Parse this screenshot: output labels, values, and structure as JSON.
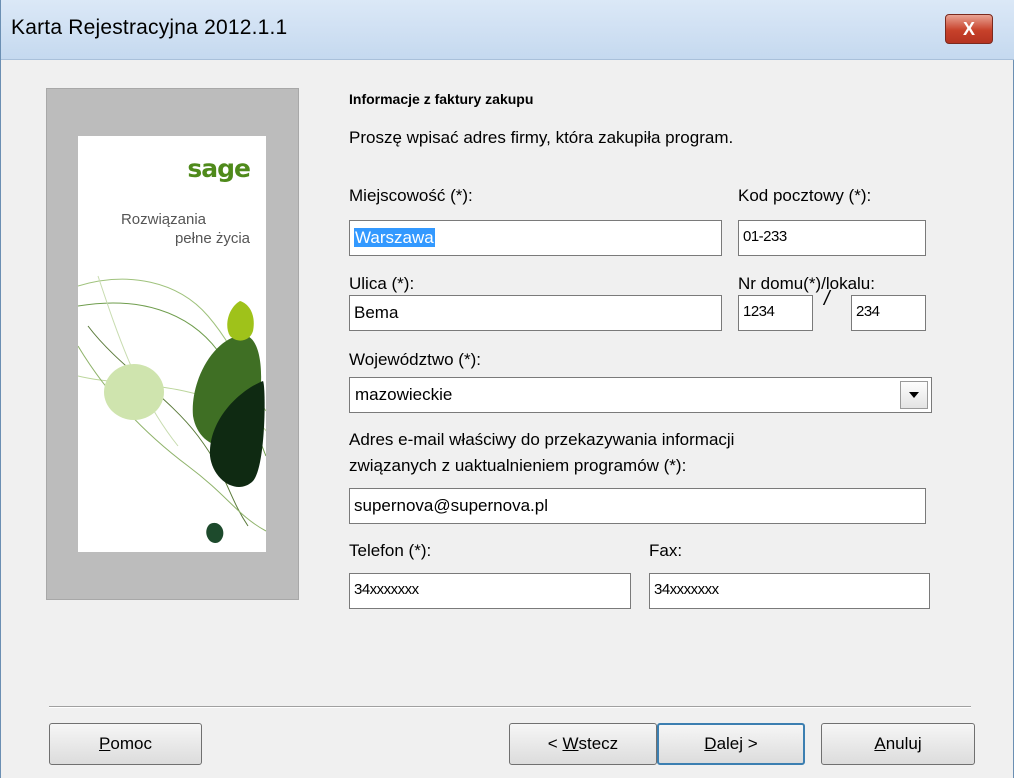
{
  "window": {
    "title": "Karta Rejestracyjna 2012.1.1",
    "close_label": "X"
  },
  "side": {
    "logo": "sage",
    "tagline_1": "Rozwiązania",
    "tagline_2": "pełne życia"
  },
  "form": {
    "heading": "Informacje z faktury zakupu",
    "description": "Proszę wpisać adres firmy, która zakupiła program.",
    "city_label": "Miejscowość (*):",
    "city_value": "Warszawa",
    "zip_label": "Kod pocztowy (*):",
    "zip_value": "01-233",
    "street_label": "Ulica (*):",
    "street_value": "Bema",
    "house_label": "Nr domu(*)/lokalu:",
    "house_value": "1234",
    "house_separator": "/",
    "flat_value": "234",
    "province_label": "Województwo (*):",
    "province_value": "mazowieckie",
    "email_label_1": "Adres e-mail właściwy do przekazywania informacji",
    "email_label_2": "związanych z uaktualnieniem programów (*):",
    "email_value": "supernova@supernova.pl",
    "phone_label": "Telefon (*):",
    "phone_value": "34xxxxxxx",
    "fax_label": "Fax:",
    "fax_value": "34xxxxxxx"
  },
  "buttons": {
    "help_prefix": "",
    "help_mnemonic": "P",
    "help_rest": "omoc",
    "back_prefix": "< ",
    "back_mnemonic": "W",
    "back_rest": "stecz",
    "next_prefix": "",
    "next_mnemonic": "D",
    "next_rest": "alej >",
    "cancel_prefix": "",
    "cancel_mnemonic": "A",
    "cancel_rest": "nuluj"
  },
  "colors": {
    "accent": "#4f8a1b",
    "selection": "#3399ff",
    "close": "#c7412a"
  },
  "icons": {
    "close": "close-icon",
    "dropdown": "chevron-down-icon"
  }
}
